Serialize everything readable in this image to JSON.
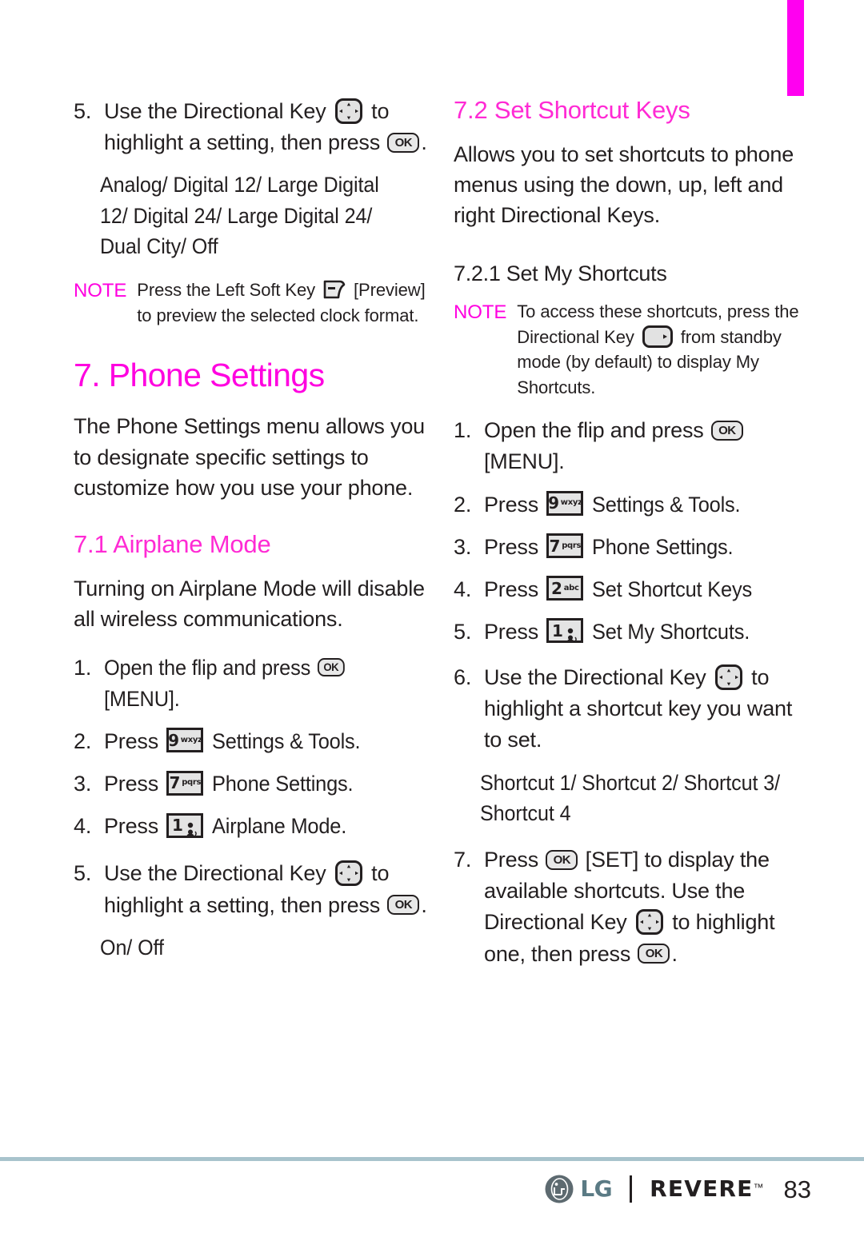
{
  "left_column": {
    "step5_clock": {
      "num": "5.",
      "text_before_icon": "Use the Directional Key",
      "icon": "directional-key-icon",
      "text_after_icon": "to highlight a setting, then press",
      "icon2": "ok-key-icon",
      "text_end": "."
    },
    "clock_options": "Analog/ Digital 12/ Large Digital 12/ Digital 24/ Large Digital 24/ Dual City/ Off",
    "note": {
      "label": "NOTE",
      "text_before_icon": "Press the Left Soft Key",
      "icon": "left-soft-key-icon",
      "text_after_icon": "[Preview] to preview the selected clock format."
    },
    "chapter_heading": "7. Phone Settings",
    "chapter_intro": "The Phone Settings menu allows you to designate specific settings to customize how you use your phone.",
    "section_heading": "7.1 Airplane Mode",
    "section_intro": "Turning on Airplane Mode will disable all wireless communications.",
    "steps": [
      {
        "num": "1.",
        "before": "Open the flip and press",
        "icon": "ok-key-icon",
        "after": "[MENU]."
      },
      {
        "num": "2.",
        "before": "Press",
        "icon": "key-9-wxyz-icon",
        "key_digit": "9",
        "key_letters": "wxyz",
        "after": "Settings & Tools."
      },
      {
        "num": "3.",
        "before": "Press",
        "icon": "key-7-pqrs-icon",
        "key_digit": "7",
        "key_letters": "pqrs",
        "after": "Phone Settings."
      },
      {
        "num": "4.",
        "before": "Press",
        "icon": "key-1-voicemail-icon",
        "key_digit": "1",
        "key_letters": "",
        "after": "Airplane Mode."
      }
    ],
    "step5_airplane": {
      "num": "5.",
      "text_before_icon": "Use the Directional Key",
      "icon": "directional-key-icon",
      "text_after_icon": "to highlight a setting, then press",
      "icon2": "ok-key-icon",
      "text_end": "."
    },
    "airplane_options": "On/ Off"
  },
  "right_column": {
    "section_heading": "7.2 Set Shortcut Keys",
    "section_intro": "Allows you to set shortcuts to phone menus using the down, up, left and right Directional Keys.",
    "subsection_heading": "7.2.1 Set My Shortcuts",
    "note": {
      "label": "NOTE",
      "text_before_icon": "To access these shortcuts, press the Directional Key",
      "icon": "directional-key-right-icon",
      "text_after_icon": "from standby mode (by default) to display My Shortcuts."
    },
    "steps": [
      {
        "num": "1.",
        "before": "Open the flip and press",
        "icon": "ok-key-icon",
        "after": "[MENU]."
      },
      {
        "num": "2.",
        "before": "Press",
        "icon": "key-9-wxyz-icon",
        "key_digit": "9",
        "key_letters": "wxyz",
        "after": "Settings & Tools."
      },
      {
        "num": "3.",
        "before": "Press",
        "icon": "key-7-pqrs-icon",
        "key_digit": "7",
        "key_letters": "pqrs",
        "after": "Phone Settings."
      },
      {
        "num": "4.",
        "before": "Press",
        "icon": "key-2-abc-icon",
        "key_digit": "2",
        "key_letters": "abc",
        "after": "Set Shortcut Keys"
      },
      {
        "num": "5.",
        "before": "Press",
        "icon": "key-1-voicemail-icon",
        "key_digit": "1",
        "key_letters": "",
        "after": "Set My Shortcuts."
      }
    ],
    "step6": {
      "num": "6.",
      "text_before_icon": "Use the Directional Key",
      "icon": "directional-key-icon",
      "text_after_icon": "to highlight a shortcut key you want to set."
    },
    "shortcut_options": "Shortcut 1/ Shortcut 2/ Shortcut 3/ Shortcut 4",
    "step7": {
      "num": "7.",
      "before_ok": "Press",
      "icon1": "ok-key-icon",
      "mid1": "[SET] to display the available shortcuts. Use the Directional Key",
      "icon2": "directional-key-icon",
      "mid2": "to highlight one, then press",
      "icon3": "ok-key-icon",
      "end": "."
    }
  },
  "footer": {
    "brand": "LG",
    "product": "REVERE",
    "trademark": "™",
    "page_number": "83"
  },
  "colors": {
    "magenta": "#ff00e0",
    "pink_heading": "#ff2ad4",
    "footer_rule": "#a8c3cc",
    "lg_gray_blue": "#5a7a84",
    "body_text": "#231f20"
  }
}
